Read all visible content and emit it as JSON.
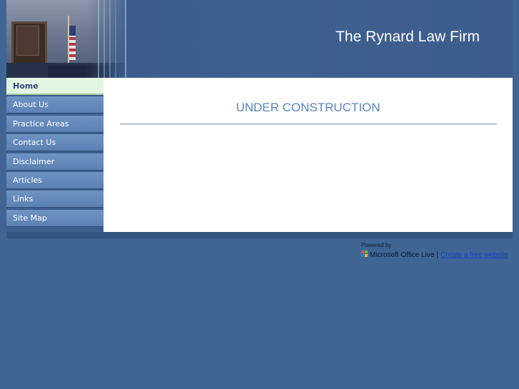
{
  "header": {
    "site_title": "The Rynard Law Firm"
  },
  "nav": {
    "items": [
      {
        "label": "Home",
        "active": true
      },
      {
        "label": "About Us",
        "active": false
      },
      {
        "label": "Practice Areas",
        "active": false
      },
      {
        "label": "Contact Us",
        "active": false
      },
      {
        "label": "Disclaimer",
        "active": false
      },
      {
        "label": "Articles",
        "active": false
      },
      {
        "label": "Links",
        "active": false
      },
      {
        "label": "Site Map",
        "active": false
      }
    ]
  },
  "main": {
    "heading": "UNDER CONSTRUCTION"
  },
  "footer": {
    "powered_by": "Powered by",
    "product_name": "Microsoft Office Live",
    "separator": "|",
    "create_link": "Create a free website"
  },
  "colors": {
    "page_background": "#3f6594",
    "nav_active_background": "#e3f6e3",
    "heading_color": "#5a84bd",
    "link_color": "#1a3fc6"
  }
}
